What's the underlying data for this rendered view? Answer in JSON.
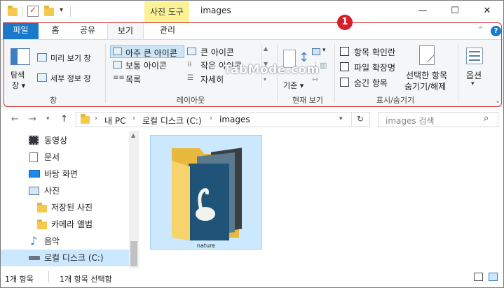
{
  "title_bar": {
    "context_tab": "사진 도구",
    "window_title": "images",
    "minimize": "—",
    "maximize": "☐",
    "close": "✕"
  },
  "ribbon_tabs": {
    "file": "파일",
    "home": "홈",
    "share": "공유",
    "view": "보기",
    "manage": "관리"
  },
  "badge_number": "1",
  "watermark": "TabMode.com",
  "ribbon": {
    "pane_group": {
      "nav_pane_label_line1": "탐색",
      "nav_pane_label_line2": "창",
      "preview_pane": "미리 보기 창",
      "details_pane": "세부 정보 창",
      "group_label": "창"
    },
    "layout_group": {
      "items": [
        "아주 큰 아이콘",
        "큰 아이콘",
        "보통 아이콘",
        "작은 아이콘",
        "목록",
        "자세히"
      ],
      "group_label": "레이아웃"
    },
    "current_view_group": {
      "sort_label": "기준",
      "group_label": "현재 보기"
    },
    "show_hide_group": {
      "item_checkboxes": "항목 확인란",
      "file_extensions": "파일 확장명",
      "hidden_items": "숨긴 항목",
      "hide_selected_line1": "선택한 항목",
      "hide_selected_line2": "숨기기/해제",
      "group_label": "표시/숨기기"
    },
    "options_label": "옵션"
  },
  "address_bar": {
    "crumb_pc": "내 PC",
    "crumb_disk": "로컬 디스크 (C:)",
    "crumb_folder": "images",
    "search_placeholder": "images 검색"
  },
  "nav_pane": {
    "items": [
      "동영상",
      "문서",
      "바탕 화면",
      "사진",
      "저장된 사진",
      "카메라 앨범",
      "음악",
      "로컬 디스크 (C:)"
    ]
  },
  "content": {
    "folder_name": "nature"
  },
  "status_bar": {
    "item_count": "1개 항목",
    "selected": "1개 항목 선택함"
  },
  "colors": {
    "accent": "#1979ca",
    "context_tab": "#fbf197",
    "selection": "#cce8ff",
    "annotation": "#d33b3b"
  }
}
